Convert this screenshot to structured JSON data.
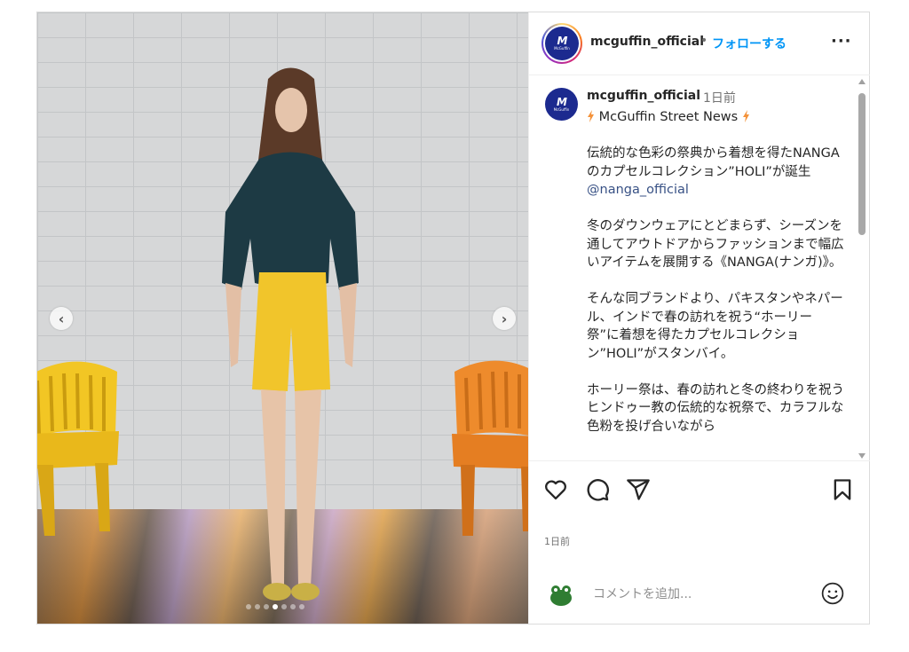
{
  "post": {
    "username": "mcguffin_official",
    "follow_label": "フォローする",
    "more_label": "···",
    "avatar_logo": "M",
    "avatar_text": "McGuffin",
    "colors": {
      "brand": "#1c2a8f",
      "follow": "#0095f6",
      "mention": "#385185",
      "bolt": "#f4923a"
    }
  },
  "caption": {
    "username": "mcguffin_official",
    "time": "1日前",
    "headline": "McGuffin Street News",
    "paragraph1": "伝統的な色彩の祭典から着想を得たNANGA のカプセルコレクション”HOLI”が誕生",
    "mention": "@nanga_official",
    "paragraph2": "冬のダウンウェアにとどまらず、シーズンを通してアウトドアからファッションまで幅広いアイテムを展開する《NANGA(ナンガ)》。",
    "paragraph3": "そんな同ブランドより、パキスタンやネパール、インドで春の訪れを祝う“ホーリー祭”に着想を得たカプセルコレクション”HOLI”がスタンバイ。",
    "paragraph4": "ホーリー祭は、春の訪れと冬の終わりを祝うヒンドゥー教の伝統的な祝祭で、カラフルな色粉を投げ合いながら"
  },
  "actions": {
    "icons": [
      "heart-icon",
      "comment-icon",
      "share-icon",
      "bookmark-icon"
    ]
  },
  "footer": {
    "time": "1日前",
    "comment_placeholder": "コメントを追加...",
    "emoji_icon": "smiley-icon"
  },
  "carousel": {
    "prev_label": "‹",
    "next_label": "›",
    "total": 7,
    "active_index": 3
  }
}
